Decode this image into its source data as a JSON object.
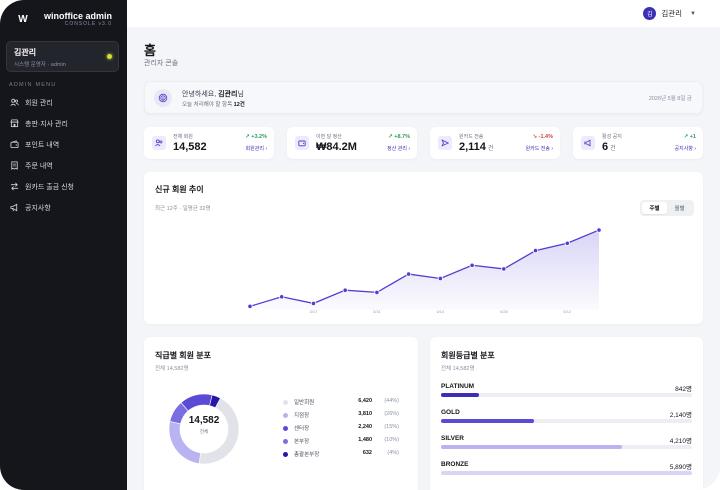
{
  "brand": {
    "logo": "W",
    "name": "winoffice admin",
    "sub": "CONSOLE v3.0"
  },
  "user_card": {
    "name": "김관리",
    "role": "시스템 운영자 · admin"
  },
  "sidebar": {
    "section_label": "ADMIN MENU",
    "items": [
      {
        "label": "회원 관리",
        "icon": "users-icon"
      },
      {
        "label": "총판·지사 관리",
        "icon": "store-icon"
      },
      {
        "label": "포인트 내역",
        "icon": "wallet-icon"
      },
      {
        "label": "주문 내역",
        "icon": "receipt-icon"
      },
      {
        "label": "원카드 출금 신청",
        "icon": "transfer-icon"
      },
      {
        "label": "공지사항",
        "icon": "megaphone-icon"
      }
    ]
  },
  "topbar": {
    "avatar": "김",
    "user": "김관리"
  },
  "page": {
    "title": "홈",
    "subtitle": "관리자 콘솔"
  },
  "welcome": {
    "greeting_pre": "안녕하세요,",
    "greeting_name": "김관리",
    "greeting_post": "님",
    "sub_pre": "오늘 처리해야 할 항목",
    "sub_count": "12건",
    "date": "2026년 5월 8일 금"
  },
  "stats": [
    {
      "label": "전체 회원",
      "value": "14,582",
      "unit": "",
      "delta": "↗ +3.2%",
      "trend": "up",
      "link": "회원관리 ›",
      "icon": "users-icon"
    },
    {
      "label": "이번 달 정산",
      "value": "₩84.2M",
      "unit": "",
      "delta": "↗ +8.7%",
      "trend": "up",
      "link": "정산 관리 ›",
      "icon": "wallet-icon"
    },
    {
      "label": "원카드 전송",
      "value": "2,114",
      "unit": "건",
      "delta": "↘ -1.4%",
      "trend": "down",
      "link": "원카드 전송 ›",
      "icon": "send-icon"
    },
    {
      "label": "활성 공지",
      "value": "6",
      "unit": "건",
      "delta": "↗ +1",
      "trend": "up",
      "link": "공지사항 ›",
      "icon": "megaphone-icon"
    }
  ],
  "trend": {
    "title": "신규 회원 추이",
    "subtitle": "최근 12주 · 일평균 32명",
    "tabs": [
      "주별",
      "월별"
    ],
    "active_tab": "주별"
  },
  "chart_data": {
    "type": "area",
    "title": "신규 회원 추이",
    "x": [
      "",
      "",
      "3/17",
      "",
      "3/31",
      "",
      "4/14",
      "",
      "4/28",
      "",
      "5/12",
      ""
    ],
    "tick_labels": [
      "",
      "3/17",
      "3/31",
      "4/14",
      "4/28",
      "5/12"
    ],
    "series": [
      {
        "values": [
          5,
          18,
          9,
          27,
          24,
          49,
          43,
          61,
          56,
          81,
          91,
          109
        ]
      }
    ],
    "ylim": [
      0,
      120
    ],
    "grid": false,
    "color": "#4f3fd1"
  },
  "distribution": {
    "title": "직급별 회원 분포",
    "subtitle": "전체 14,582명",
    "total": "14,582",
    "total_unit": "전체",
    "items": [
      {
        "name": "일반회원",
        "count": "6,420",
        "pct": "(44%)",
        "value": 44,
        "color": "#e2e3e8"
      },
      {
        "name": "지점장",
        "count": "3,810",
        "pct": "(26%)",
        "value": 26,
        "color": "#b9b3f2"
      },
      {
        "name": "센터장",
        "count": "2,240",
        "pct": "(15%)",
        "value": 15,
        "color": "#5a4bd6"
      },
      {
        "name": "본부장",
        "count": "1,480",
        "pct": "(10%)",
        "value": 10,
        "color": "#7a6ee0"
      },
      {
        "name": "총괄본부장",
        "count": "632",
        "pct": "(4%)",
        "value": 4,
        "color": "#2517a8"
      }
    ]
  },
  "grades": {
    "title": "회원등급별 분포",
    "subtitle": "전체 14,582명",
    "items": [
      {
        "name": "PLATINUM",
        "count": "842명",
        "fraction": 0.15,
        "color": "#3b2fb7"
      },
      {
        "name": "GOLD",
        "count": "2,140명",
        "fraction": 0.37,
        "color": "#5a4bd6"
      },
      {
        "name": "SILVER",
        "count": "4,210명",
        "fraction": 0.72,
        "color": "#b9b3f2"
      },
      {
        "name": "BRONZE",
        "count": "5,890명",
        "fraction": 1.0,
        "color": "#d9d6f5"
      }
    ]
  }
}
